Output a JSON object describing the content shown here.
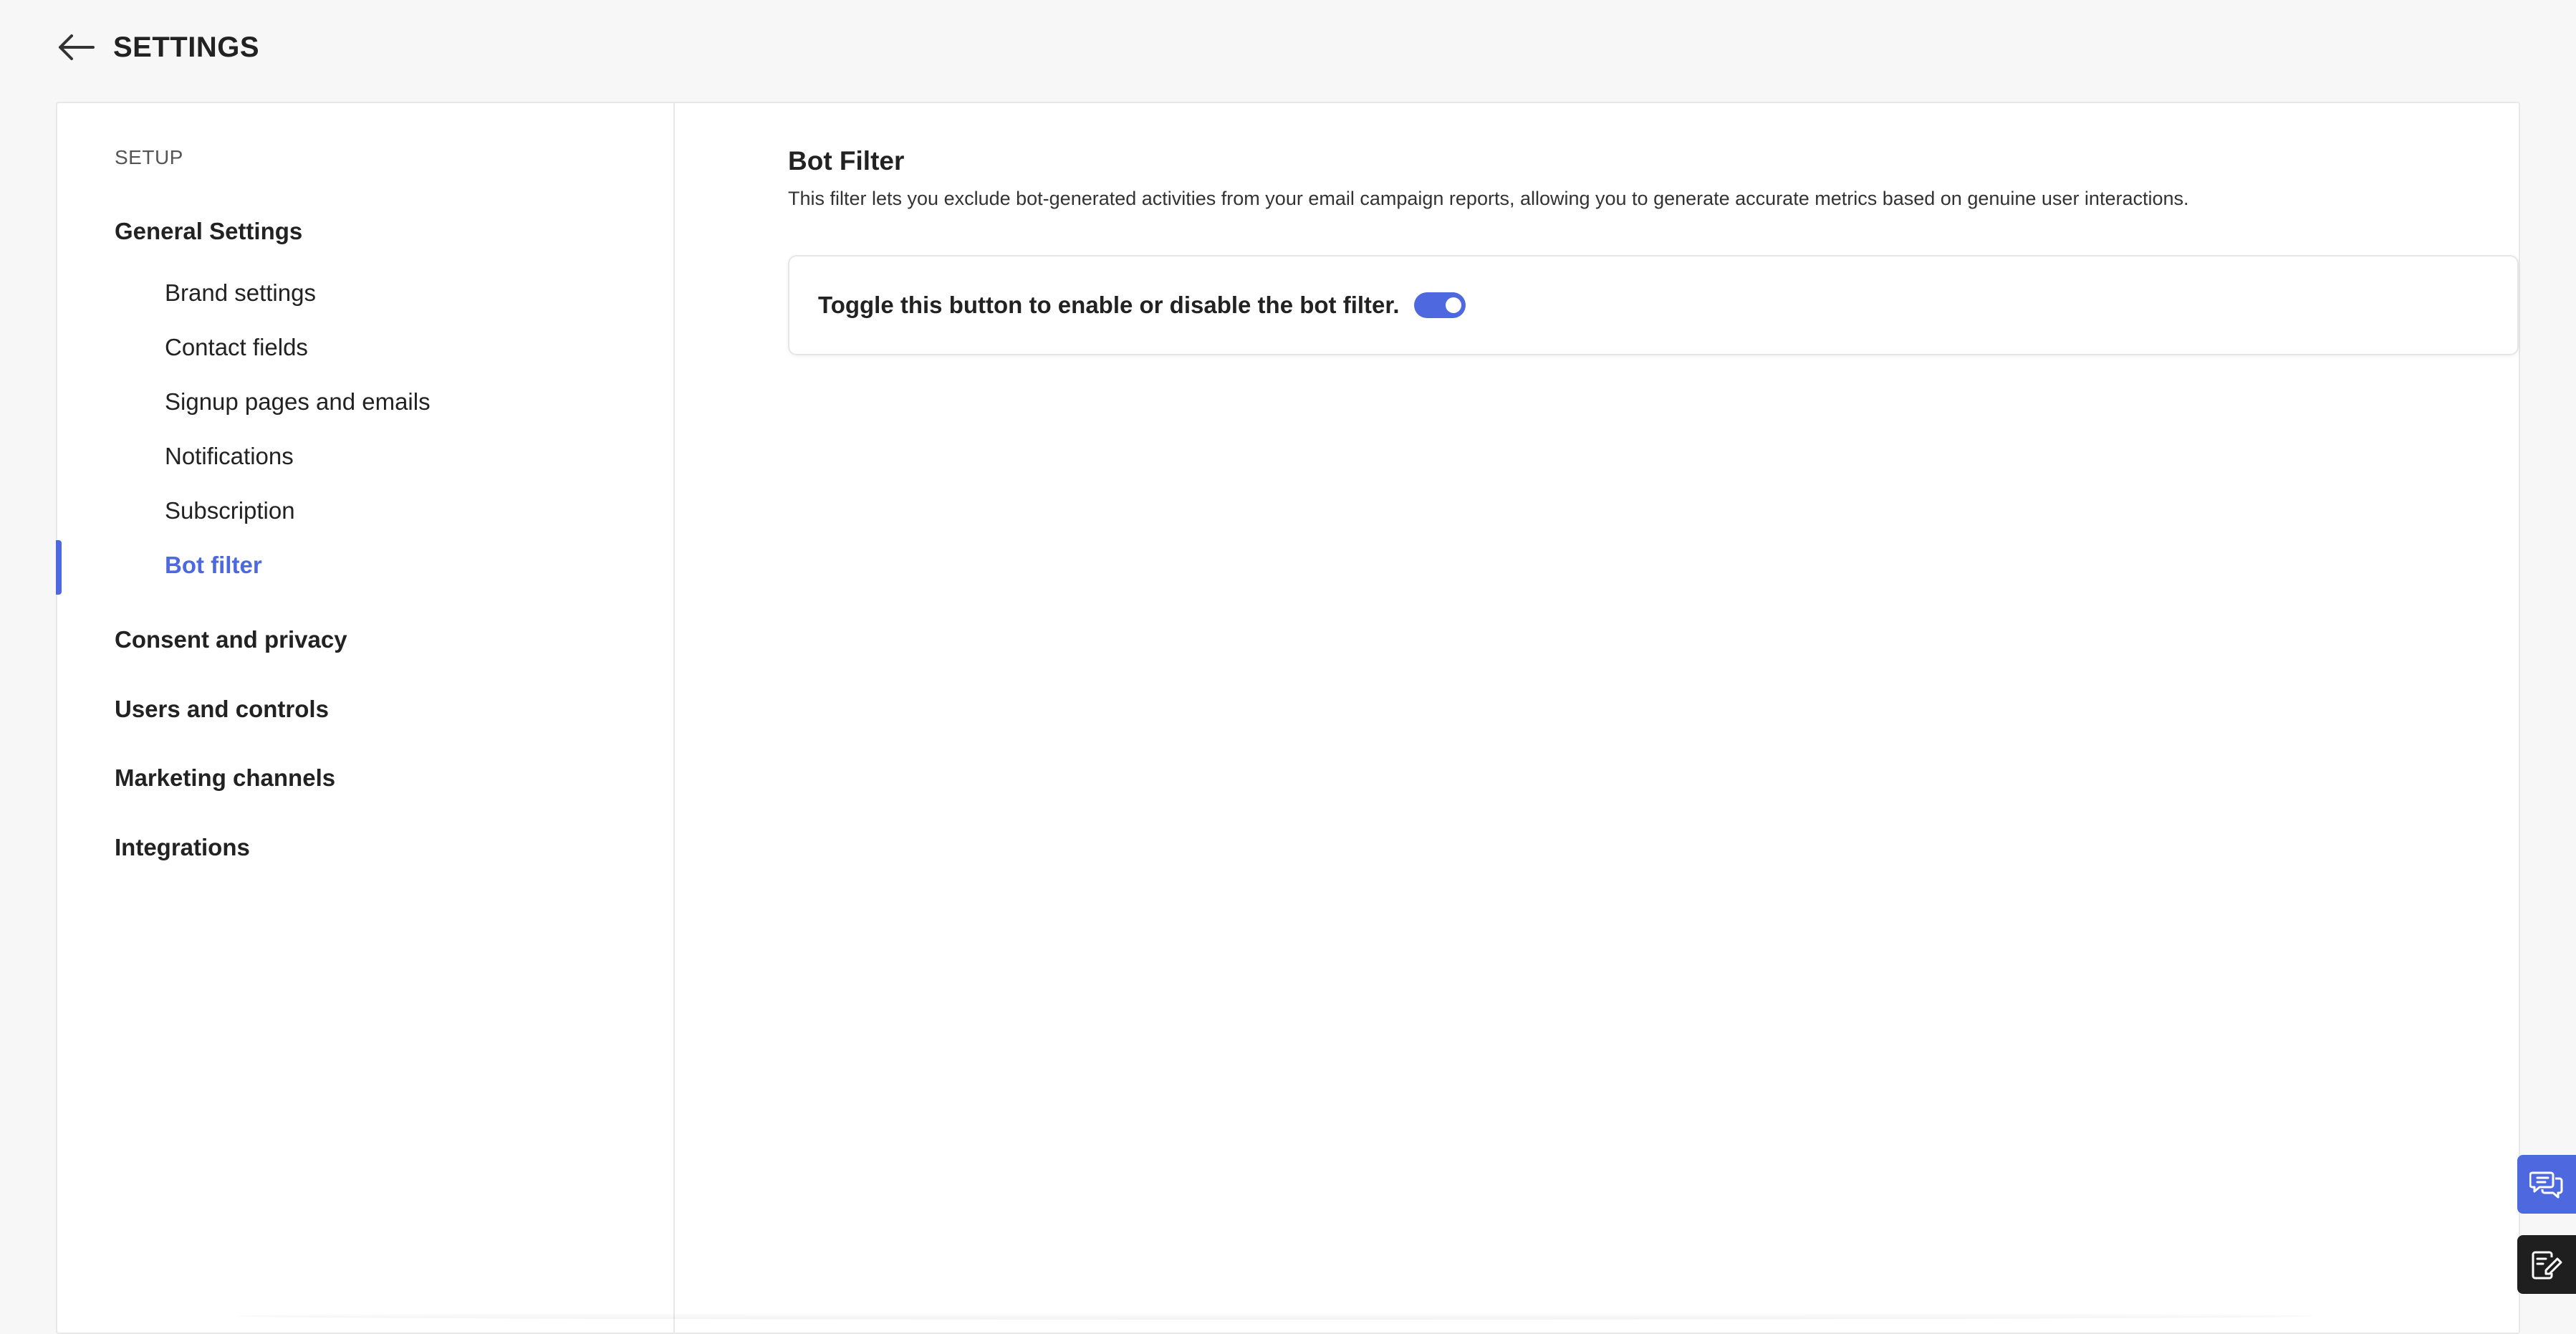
{
  "header": {
    "title": "SETTINGS",
    "back_icon": "arrow-left-icon"
  },
  "sidebar": {
    "section_label": "SETUP",
    "groups": [
      {
        "label": "General Settings",
        "items": [
          {
            "label": "Brand settings"
          },
          {
            "label": "Contact fields"
          },
          {
            "label": "Signup pages and emails"
          },
          {
            "label": "Notifications"
          },
          {
            "label": "Subscription"
          },
          {
            "label": "Bot filter",
            "active": true
          }
        ]
      },
      {
        "label": "Consent and privacy"
      },
      {
        "label": "Users and controls"
      },
      {
        "label": "Marketing channels"
      },
      {
        "label": "Integrations"
      }
    ],
    "active_color": "#4e68e0"
  },
  "main": {
    "title": "Bot Filter",
    "description": "This filter lets you exclude bot-generated activities from your email campaign reports, allowing you to generate accurate metrics based on genuine user interactions.",
    "toggle_label": "Toggle this button to enable or disable the bot filter.",
    "toggle_state": "on"
  },
  "floating": {
    "chat_icon": "chat-bubbles-icon",
    "note_icon": "edit-note-icon"
  }
}
